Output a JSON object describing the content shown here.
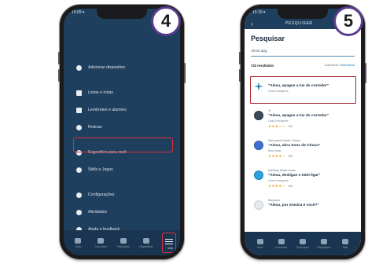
{
  "steps": {
    "left_number": "4",
    "right_number": "5"
  },
  "left_screen": {
    "status_time": "15:09 ▾",
    "menu_items": [
      {
        "icon": "plus-icon",
        "label": "Adicionar dispositivo"
      },
      {
        "icon": "list-icon",
        "label": "Listas e notas"
      },
      {
        "icon": "reminder-icon",
        "label": "Lembretes e alarmes"
      },
      {
        "icon": "history-icon",
        "label": "Rotinas"
      },
      {
        "icon": "idea-icon",
        "label": "Sugestões para você"
      },
      {
        "icon": "skills-icon",
        "label": "Skills e Jogos"
      },
      {
        "icon": "gear-icon",
        "label": "Configurações"
      },
      {
        "icon": "activity-icon",
        "label": "Atividades"
      },
      {
        "icon": "help-icon",
        "label": "Ajuda e feedback"
      }
    ],
    "bottom_nav": [
      {
        "icon": "home-icon",
        "label": "Início"
      },
      {
        "icon": "chat-icon",
        "label": "Comunicar"
      },
      {
        "icon": "play-icon",
        "label": "Reproduzir"
      },
      {
        "icon": "devices-icon",
        "label": "Dispositivos"
      }
    ],
    "more_label": "Mais"
  },
  "right_screen": {
    "status_time": "15:10 ▾",
    "topbar_title": "PESQUISAR",
    "page_title": "Pesquisar",
    "search_value": "Alexa apg",
    "results_count": "742 resultados",
    "sort_prefix": "Classificar:",
    "sort_value": "Relevância",
    "results": [
      {
        "logo": "sparkle-icon",
        "dev_top": "",
        "title": "\"Alexa, apague a luz do corredor\"",
        "sub": "Casa Inteligente",
        "stars": "",
        "count": ""
      },
      {
        "logo": "device-icon",
        "dev_top": "Yi",
        "title": "\"Alexa, apague a luz do corredor\"",
        "sub": "Casa Inteligente",
        "stars": "★★★☆☆",
        "count": "106"
      },
      {
        "logo": "sound-icon",
        "dev_top": "Sons para Dormir: Chuva",
        "title": "\"Alexa, abra Sons de Chuva\"",
        "sub": "Bem-estar",
        "stars": "★★★★☆",
        "count": "108"
      },
      {
        "logo": "cloud-icon",
        "dev_top": "Intelbras Smart Home",
        "title": "\"Alexa, desligue o Intel ligar\"",
        "sub": "Casa Inteligente",
        "stars": "★★★★☆",
        "count": "106"
      },
      {
        "logo": "face-icon",
        "dev_top": "Surpresa",
        "title": "\"Alexa, por música é você?\"",
        "sub": "",
        "stars": "",
        "count": ""
      }
    ],
    "bottom_nav": [
      {
        "icon": "home-icon",
        "label": "Início"
      },
      {
        "icon": "chat-icon",
        "label": "Comunicar"
      },
      {
        "icon": "play-icon",
        "label": "Reproduzir"
      },
      {
        "icon": "devices-icon",
        "label": "Dispositivos"
      },
      {
        "icon": "more-icon",
        "label": "Mais"
      }
    ]
  }
}
